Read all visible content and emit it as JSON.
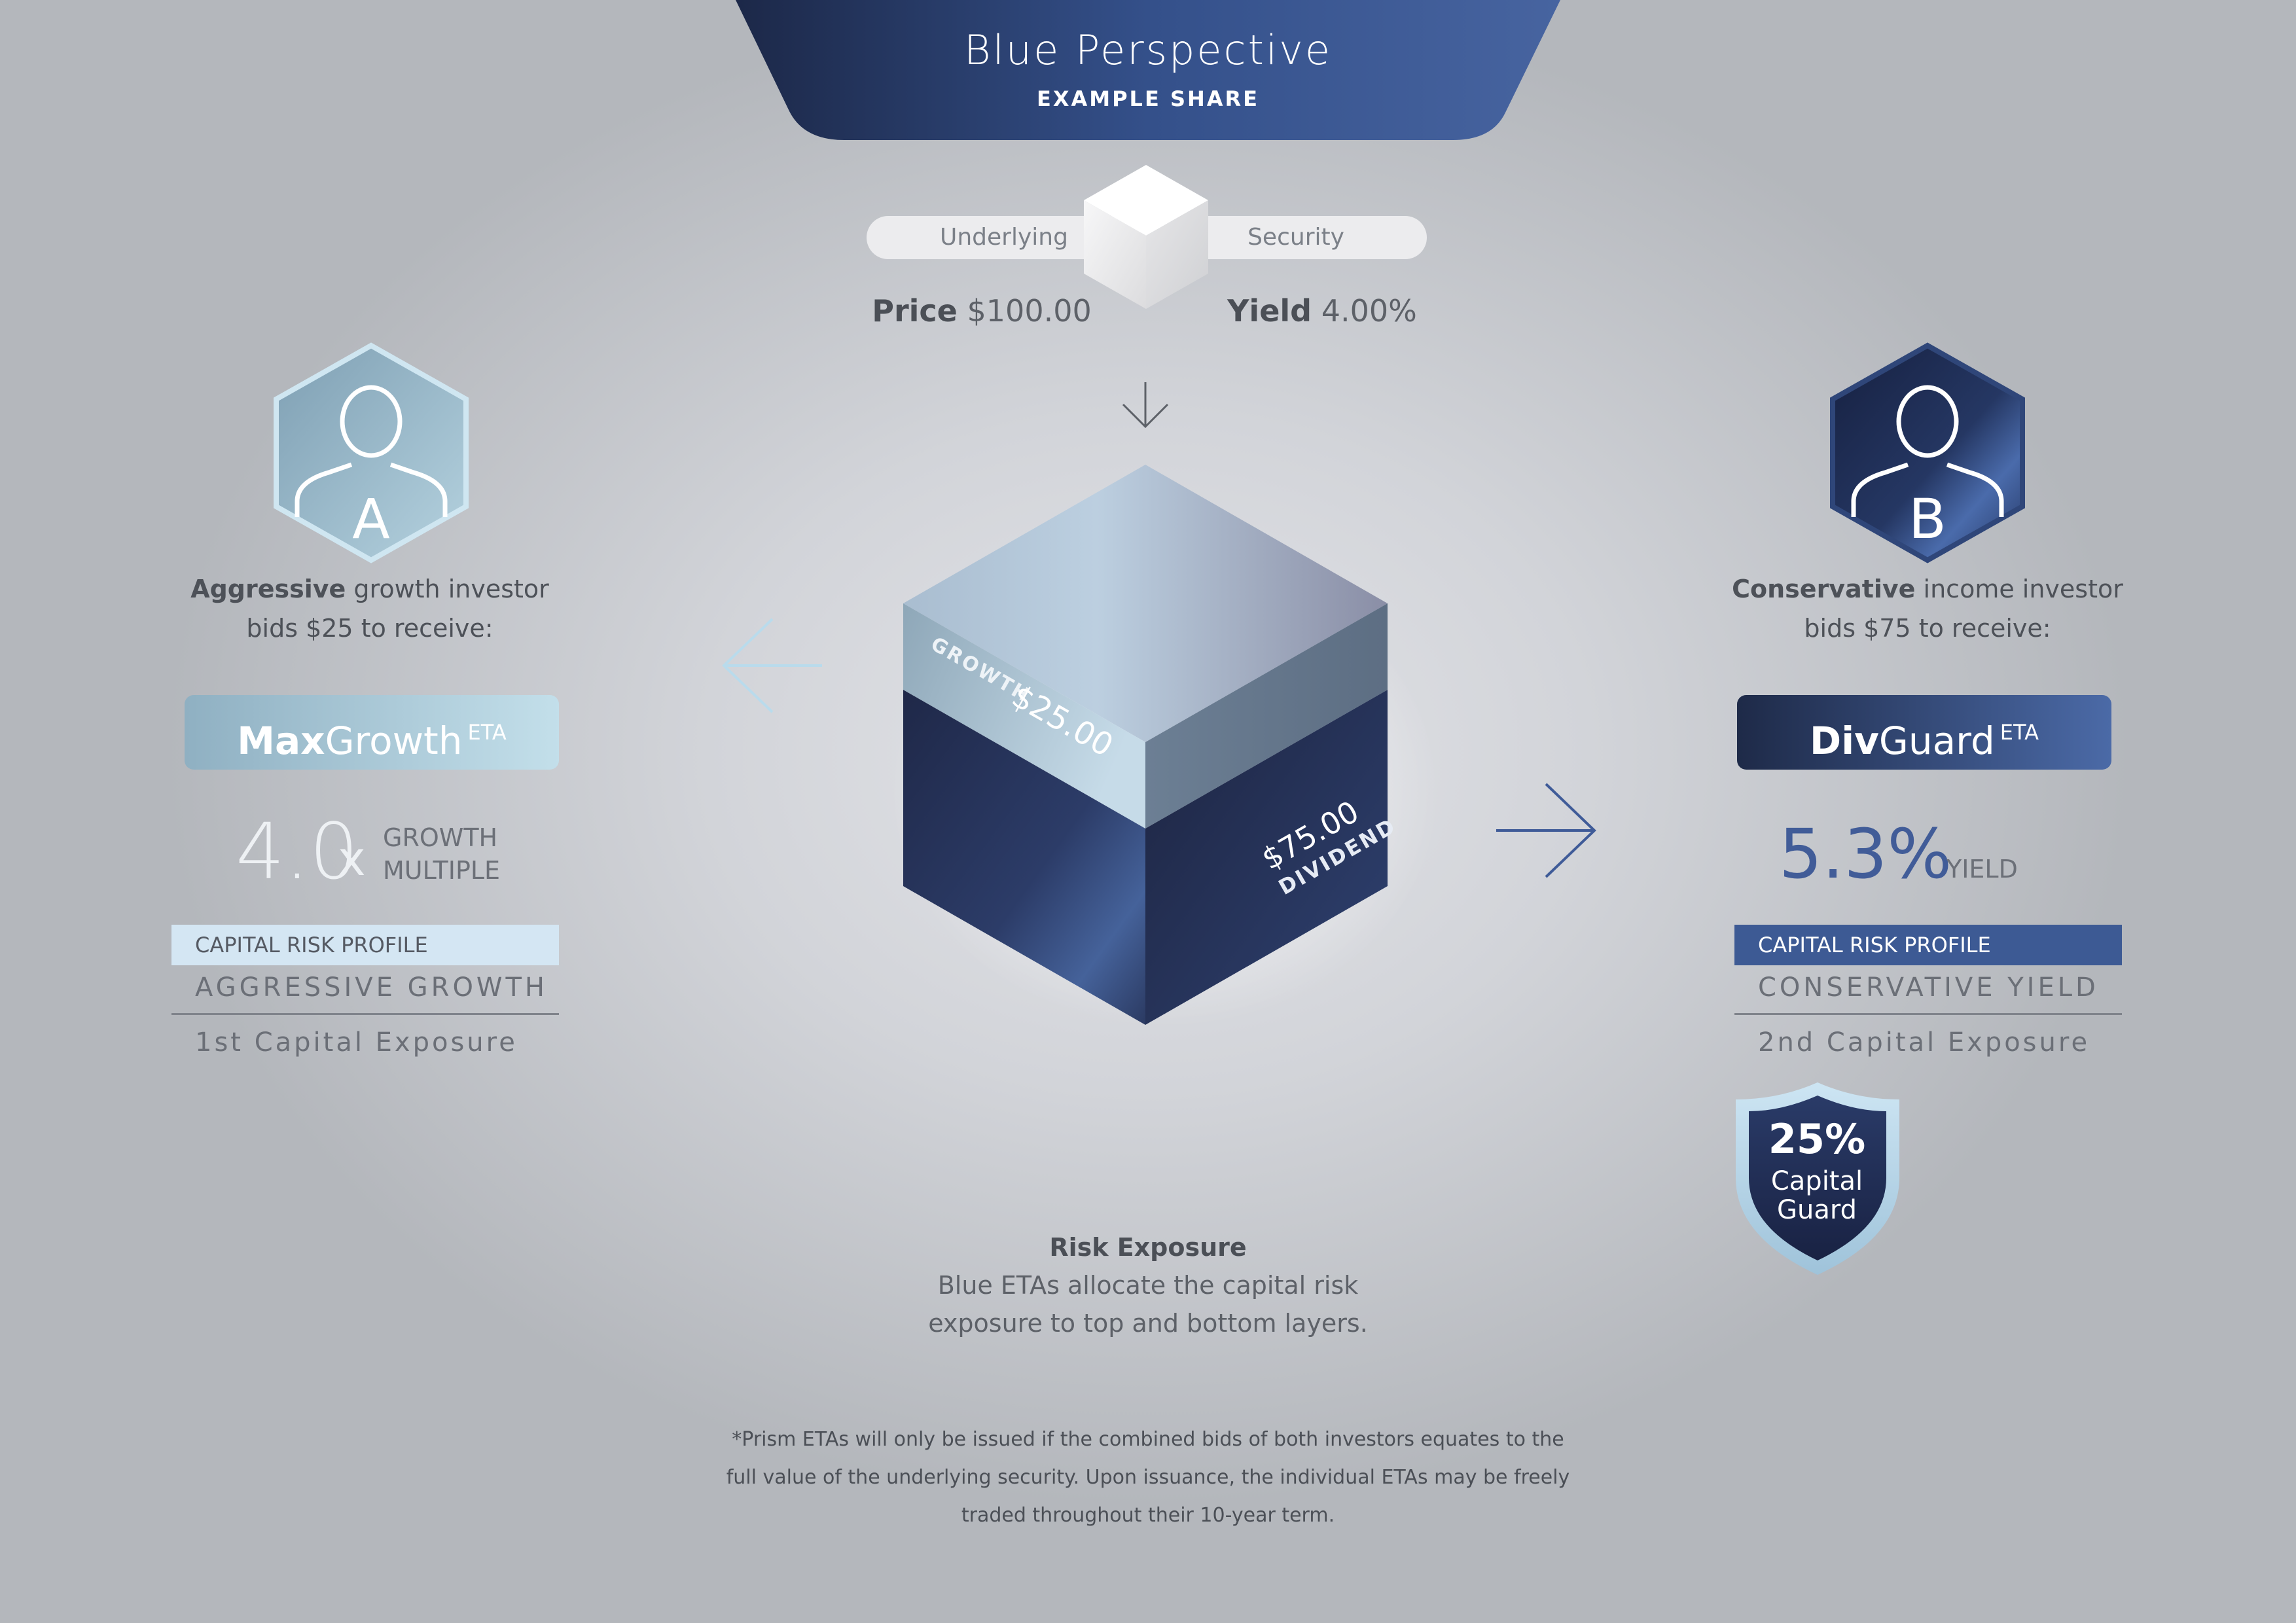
{
  "header": {
    "title": "Blue Perspective",
    "subtitle": "EXAMPLE SHARE"
  },
  "security": {
    "left_label": "Underlying",
    "right_label": "Security",
    "price_label": "Price",
    "price_value": "$100.00",
    "yield_label": "Yield",
    "yield_value": "4.00%"
  },
  "cube": {
    "top_layer_label": "GROWTH",
    "top_layer_value": "$25.00",
    "bottom_layer_value": "$75.00",
    "bottom_layer_label": "DIVIDEND"
  },
  "investor_a": {
    "badge_letter": "A",
    "bold_word": "Aggressive",
    "rest_line1": " growth investor",
    "line2": "bids $25 to receive:",
    "product_bold": "Max",
    "product_rest": "Growth",
    "product_sup": "ETA",
    "metric_value": "4.0",
    "metric_unit": "x",
    "metric_label_1": "GROWTH",
    "metric_label_2": "MULTIPLE",
    "risk_profile_label": "CAPITAL RISK PROFILE",
    "risk_profile_value": "AGGRESSIVE GROWTH",
    "exposure": "1st Capital Exposure"
  },
  "investor_b": {
    "badge_letter": "B",
    "bold_word": "Conservative",
    "rest_line1": " income investor",
    "line2": "bids $75 to receive:",
    "product_bold": "Div",
    "product_rest": "Guard",
    "product_sup": "ETA",
    "metric_value": "5.3%",
    "metric_label": "YIELD",
    "risk_profile_label": "CAPITAL RISK PROFILE",
    "risk_profile_value": "CONSERVATIVE YIELD",
    "exposure": "2nd Capital Exposure",
    "guard_pct": "25%",
    "guard_line1": "Capital",
    "guard_line2": "Guard"
  },
  "risk_exposure": {
    "title": "Risk Exposure",
    "line1": "Blue ETAs allocate the capital risk",
    "line2": "exposure to top and bottom layers."
  },
  "footnote": {
    "line1": "*Prism ETAs will only be issued if the combined bids of both investors equates to the",
    "line2": "full value of the underlying security. Upon issuance, the individual ETAs may be freely",
    "line3": "traded throughout their 10-year term."
  },
  "colors": {
    "navy": "#1e2a48",
    "brand_blue": "#415c98",
    "light_blue": "#c3dfea",
    "text_gray": "#5d6168"
  },
  "icons": [
    "person-icon",
    "cube-icon",
    "arrow-down-icon",
    "arrow-left-icon",
    "arrow-right-icon",
    "shield-icon",
    "hexagon-badge-icon"
  ]
}
